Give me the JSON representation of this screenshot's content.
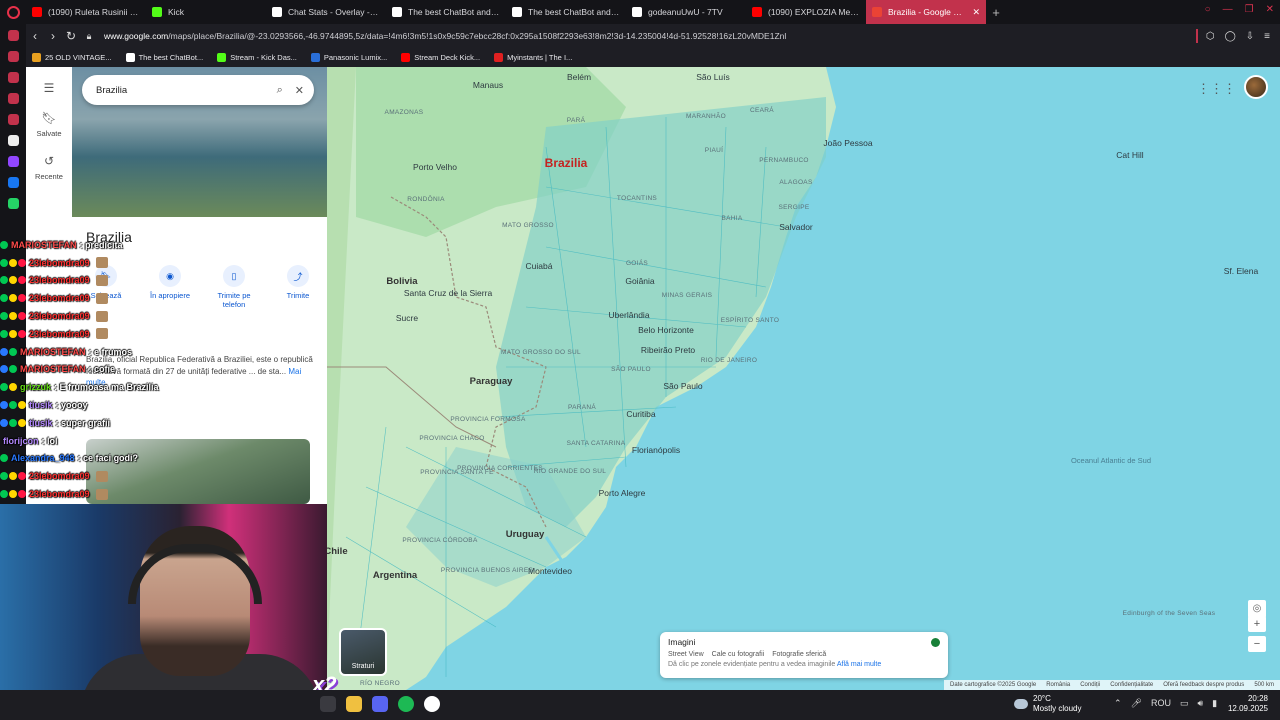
{
  "browser": {
    "tabs": [
      {
        "title": "(1090) Ruleta Rusinii cu J",
        "favicon_color": "#ff0000",
        "active": false
      },
      {
        "title": "Kick",
        "favicon_color": "#53fc18",
        "active": false
      },
      {
        "title": "Chat Stats - Overlay - Kic",
        "favicon_color": "#ffffff",
        "active": false
      },
      {
        "title": "The best ChatBot and Wi",
        "favicon_color": "#ffffff",
        "active": false
      },
      {
        "title": "The best ChatBot and Wi",
        "favicon_color": "#ffffff",
        "active": false
      },
      {
        "title": "godeanuUwU - 7TV",
        "favicon_color": "#ffffff",
        "active": false
      },
      {
        "title": "(1090) EXPLOZIA Merced",
        "favicon_color": "#ff0000",
        "active": false
      },
      {
        "title": "Brazilia - Google Maps",
        "favicon_color": "#ea4335",
        "active": true
      }
    ],
    "url_domain": "www.google.com",
    "url_path": "/maps/place/Brazilia/@-23.0293566,-46.9744895,5z/data=!4m6!3m5!1s0x9c59c7ebcc28cf:0x295a1508f2293e63!8m2!3d-14.235004!4d-51.92528!16zL20vMDE1Znl",
    "bookmarks": [
      {
        "label": "25 OLD VINTAGE...",
        "color": "#e8a020"
      },
      {
        "label": "The best ChatBot...",
        "color": "#ffffff"
      },
      {
        "label": "Stream - Kick Das...",
        "color": "#53fc18"
      },
      {
        "label": "Panasonic Lumix...",
        "color": "#2a6fd8"
      },
      {
        "label": "Stream Deck Kick...",
        "color": "#ff0000"
      },
      {
        "label": "Myinstants | The I...",
        "color": "#e02020"
      }
    ],
    "accent": "#c2324c"
  },
  "maps": {
    "search_value": "Brazilia",
    "rail": {
      "saved": "Salvate",
      "recent": "Recente"
    },
    "place_title": "Brazilia",
    "actions": [
      {
        "label": "Salvează",
        "icon": "bookmark-icon"
      },
      {
        "label": "În apropiere",
        "icon": "nearby-icon"
      },
      {
        "label": "Trimite pe telefon",
        "icon": "phone-icon"
      },
      {
        "label": "Trimite",
        "icon": "share-icon"
      }
    ],
    "description": "Brazilia, oficial Republica Federativă a Braziliei, este o republică federativă formată din 27 de unități federative ... de sta...",
    "more_link": "Mai multe",
    "layers_label": "Straturi",
    "imagini": {
      "title": "Imagini",
      "legend": [
        "Street View",
        "Cale cu fotografii",
        "Fotografie sferică"
      ],
      "hint": "Dă clic pe zonele evidențiate pentru a vedea imaginile",
      "hint_link": "Află mai multe"
    },
    "attribution": [
      "Date cartografice ©2025 Google",
      "România",
      "Condiții",
      "Confidențialitate",
      "Oferă feedback despre produs",
      "500 km"
    ],
    "labels": {
      "capital": "Brazilia",
      "countries": [
        "Bolivia",
        "Paraguay",
        "Uruguay",
        "Argentina",
        "Chile"
      ],
      "cities": [
        "São Luís",
        "Manaus",
        "Belém",
        "João Pessoa",
        "Salvador",
        "Goiânia",
        "Belo Horizonte",
        "Santa Cruz de la Sierra",
        "São Paulo",
        "Curitiba",
        "Porto Alegre",
        "Montevideo",
        "Porto Velho",
        "Cuiabá",
        "Uberlândia",
        "Ribeirão Preto",
        "Florianópolis",
        "Sucre",
        "Sf. Elena",
        "Cat Hill"
      ],
      "states": [
        "AMAZONAS",
        "PARÁ",
        "MARANHÃO",
        "CEARÁ",
        "PIAUÍ",
        "PERNAMBUCO",
        "ALAGOAS",
        "SERGIPE",
        "BAHIA",
        "TOCANTINS",
        "RONDÔNIA",
        "MATO GROSSO",
        "GOIÁS",
        "MINAS GERAIS",
        "ESPÍRITO SANTO",
        "RIO DE JANEIRO",
        "SÃO PAULO",
        "PARANÁ",
        "SANTA CATARINA",
        "RIO GRANDE DO SUL",
        "MATO GROSSO DO SUL",
        "PROVINCIA CHACO",
        "PROVINCIA FORMOSA",
        "PROVINCIA SANTA FE",
        "PROVINCIA CORRIENTES",
        "PROVINCIA CÓRDOBA",
        "PROVINCIA BUENOS AIRES",
        "RÍO NEGRO",
        "Edinburgh of the Seven Seas"
      ],
      "ocean": "Oceanul Atlantic de Sud"
    }
  },
  "chat": [
    {
      "user": "MARIOSTEFAN",
      "color": "#ff4b4b",
      "text": ": predicita",
      "badges": [
        "#00c853"
      ]
    },
    {
      "user": "23lebomdra09",
      "color": "#ff3030",
      "text": "",
      "badges": [
        "#00c853",
        "#ffd600",
        "#ff1744"
      ],
      "emote": true
    },
    {
      "user": "23lebomdra09",
      "color": "#ff3030",
      "text": "",
      "badges": [
        "#00c853",
        "#ffd600",
        "#ff1744"
      ],
      "emote": true
    },
    {
      "user": "23lebomdra09",
      "color": "#ff3030",
      "text": "",
      "badges": [
        "#00c853",
        "#ffd600",
        "#ff1744"
      ],
      "emote": true
    },
    {
      "user": "23lebomdra09",
      "color": "#ff3030",
      "text": "",
      "badges": [
        "#00c853",
        "#ffd600",
        "#ff1744"
      ],
      "emote": true
    },
    {
      "user": "23lebomdra09",
      "color": "#ff3030",
      "text": "",
      "badges": [
        "#00c853",
        "#ffd600",
        "#ff1744"
      ],
      "emote": true
    },
    {
      "user": "MARIOSTEFAN",
      "color": "#ff4b4b",
      "text": ": e frumos",
      "badges": [
        "#2979ff",
        "#00c853"
      ]
    },
    {
      "user": "MARIOSTEFAN",
      "color": "#ff4b4b",
      "text": ": cofie",
      "badges": [
        "#2979ff",
        "#00c853"
      ]
    },
    {
      "user": "grizzuk",
      "color": "#64dd17",
      "text": ": E frumoasa ma Brazilia",
      "badges": [
        "#00c853",
        "#ffd600"
      ]
    },
    {
      "user": "tiusik",
      "color": "#b388ff",
      "text": ": yoooy",
      "badges": [
        "#2979ff",
        "#00c853",
        "#ffd600"
      ]
    },
    {
      "user": "tiusik",
      "color": "#b388ff",
      "text": ": super grafii",
      "badges": [
        "#2979ff",
        "#00c853",
        "#ffd600"
      ]
    },
    {
      "user": "florijcon",
      "color": "#b388ff",
      "text": ": lol",
      "badges": []
    },
    {
      "user": "Alexandra_948",
      "color": "#2979ff",
      "text": ": ce faci godi?",
      "badges": [
        "#00c853"
      ]
    },
    {
      "user": "23lebomdra09",
      "color": "#ff3030",
      "text": "",
      "badges": [
        "#00c853",
        "#ffd600",
        "#ff1744"
      ],
      "emote": true
    },
    {
      "user": "23lebomdra09",
      "color": "#ff3030",
      "text": "",
      "badges": [
        "#00c853",
        "#ffd600",
        "#ff1744"
      ],
      "emote": true
    }
  ],
  "overlay": {
    "multiplier": "x2"
  },
  "taskbar": {
    "temp": "20°C",
    "weather": "Mostly cloudy",
    "lang": "ROU",
    "time": "20:28",
    "date": "12.09.2025"
  }
}
